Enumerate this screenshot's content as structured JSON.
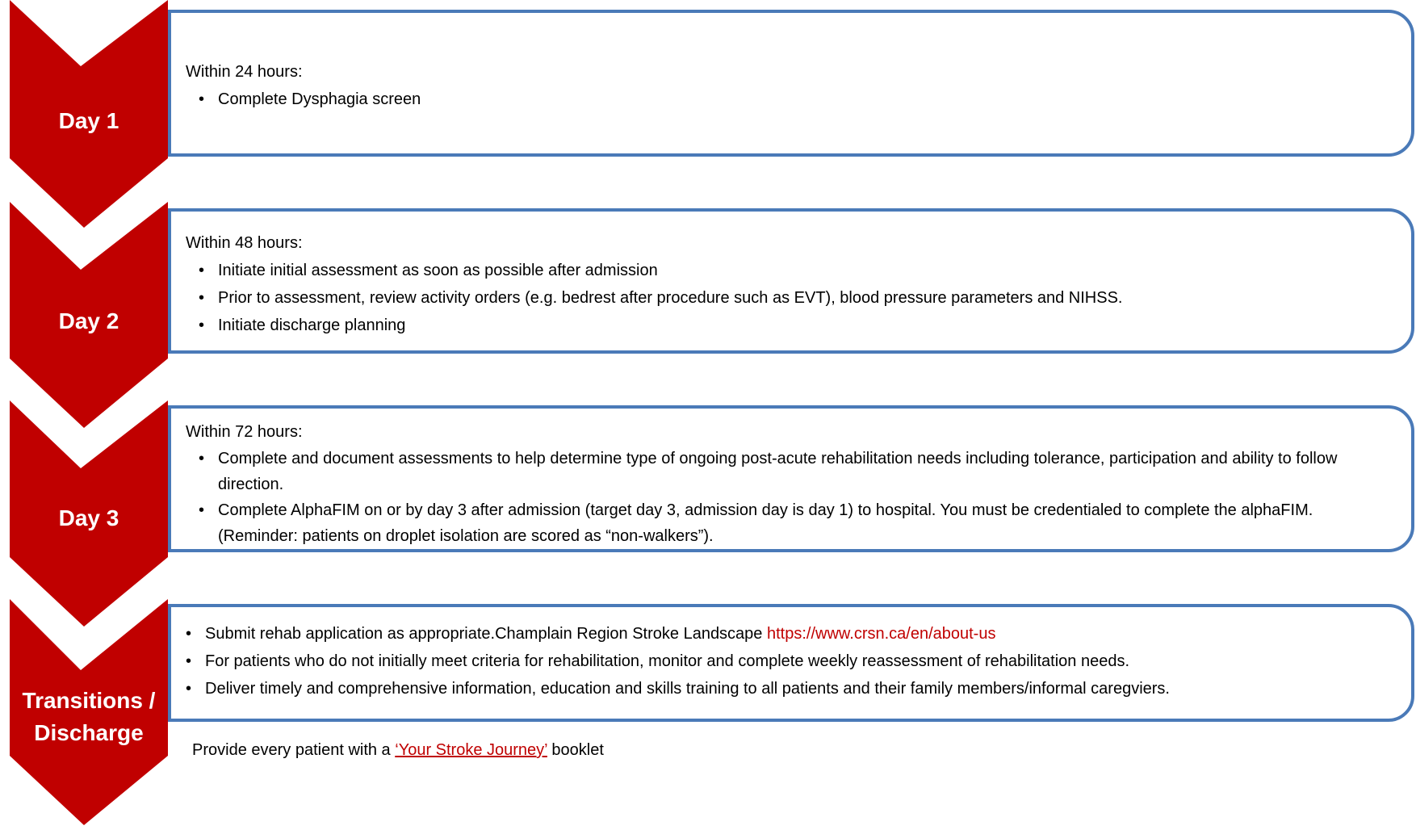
{
  "colors": {
    "chevron": "#c00000",
    "box_border": "#4a7ab8",
    "link": "#c00000"
  },
  "steps": [
    {
      "label": "Day 1",
      "heading": "Within 24 hours:",
      "bullets": [
        "Complete Dysphagia screen"
      ]
    },
    {
      "label": "Day 2",
      "heading": "Within 48 hours:",
      "bullets": [
        "Initiate initial assessment as soon as possible after admission",
        "Prior to assessment, review activity orders (e.g. bedrest after procedure such as EVT), blood pressure parameters and NIHSS.",
        "Initiate discharge planning"
      ]
    },
    {
      "label": "Day 3",
      "heading": "Within 72 hours:",
      "bullets": [
        "Complete and document assessments to help determine type of ongoing post-acute rehabilitation needs including tolerance, participation and ability to follow direction.",
        "Complete AlphaFIM on or by day 3 after admission (target day 3, admission day is day 1) to hospital.  You must be credentialed to complete the alphaFIM. (Reminder: patients on droplet isolation are scored as “non-walkers”)."
      ]
    },
    {
      "label_line1": "Transitions /",
      "label_line2": "Discharge",
      "bullet1_text": "Submit rehab application as appropriate.Champlain Region Stroke  Landscape ",
      "bullet1_link": "https://www.crsn.ca/en/about-us",
      "bullets": [
        "For patients who do not initially meet criteria for rehabilitation, monitor and complete weekly reassessment of rehabilitation needs.",
        "Deliver timely and comprehensive information, education and skills training to all patients and their family members/informal caregviers."
      ]
    }
  ],
  "footer": {
    "prefix": "Provide every patient with a ",
    "link_text": "‘Your Stroke Journey’",
    "suffix": " booklet"
  },
  "bullet_char": "•"
}
